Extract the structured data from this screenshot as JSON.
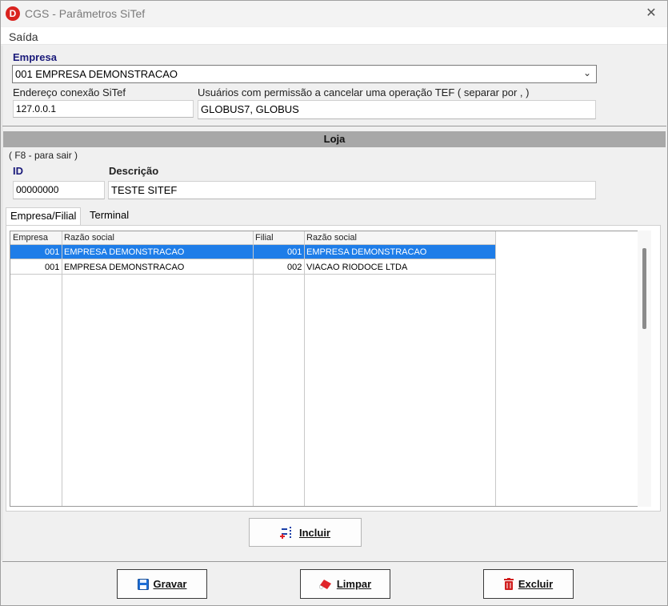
{
  "window": {
    "title": "CGS - Parâmetros SiTef",
    "logo_letter": "D"
  },
  "menu": {
    "items": [
      "Saída"
    ]
  },
  "empresa": {
    "label": "Empresa",
    "selected": "001 EMPRESA DEMONSTRACAO"
  },
  "endereco": {
    "label": "Endereço conexão SiTef",
    "value": "127.0.0.1"
  },
  "usuarios": {
    "label": "Usuários com permissão a cancelar uma operação TEF ( separar por , )",
    "value": "GLOBUS7, GLOBUS"
  },
  "loja": {
    "header": "Loja",
    "hint": "( F8 - para sair )",
    "id_label": "ID",
    "id_value": "00000000",
    "descricao_label": "Descrição",
    "descricao_value": "TESTE SITEF"
  },
  "tabs": [
    {
      "label": "Empresa/Filial",
      "active": true
    },
    {
      "label": "Terminal",
      "active": false
    }
  ],
  "grid": {
    "headers": [
      "Empresa",
      "Razão social",
      "Filial",
      "Razão social"
    ],
    "rows": [
      {
        "empresa": "001",
        "razao_empresa": "EMPRESA DEMONSTRACAO",
        "filial": "001",
        "razao_filial": "EMPRESA DEMONSTRACAO",
        "selected": true
      },
      {
        "empresa": "001",
        "razao_empresa": "EMPRESA DEMONSTRACAO",
        "filial": "002",
        "razao_filial": "VIACAO RIODOCE LTDA",
        "selected": false
      }
    ]
  },
  "buttons": {
    "incluir": "Incluir",
    "gravar": "Gravar",
    "limpar": "Limpar",
    "excluir": "Excluir"
  },
  "colors": {
    "selection": "#1e7de8",
    "label_blue": "#1a1a7a",
    "logo_red": "#d9231f",
    "loja_bar": "#a8a8a8"
  }
}
